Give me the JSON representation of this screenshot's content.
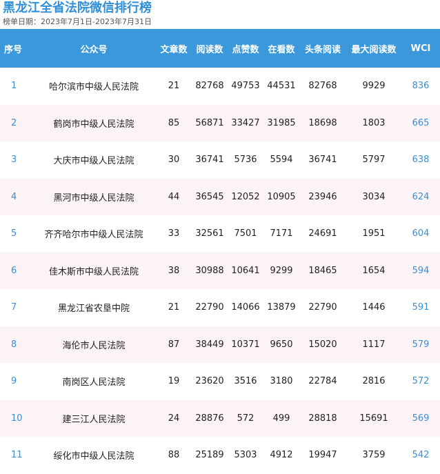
{
  "title": "黑龙江全省法院微信排行榜",
  "subtitle": "榜单日期：2023年7月1日-2023年7月31日",
  "columns": [
    "序号",
    "公众号",
    "文章数",
    "阅读数",
    "点赞数",
    "在看数",
    "头条阅读",
    "最大阅读数",
    "WCI"
  ],
  "rows": [
    [
      "1",
      "哈尔滨市中级人民法院",
      "21",
      "82768",
      "49753",
      "44531",
      "82768",
      "9929",
      "836"
    ],
    [
      "2",
      "鹤岗市中级人民法院",
      "85",
      "56871",
      "33427",
      "31985",
      "18698",
      "1803",
      "665"
    ],
    [
      "3",
      "大庆市中级人民法院",
      "30",
      "36741",
      "5736",
      "5594",
      "36741",
      "5797",
      "638"
    ],
    [
      "4",
      "黑河市中级人民法院",
      "44",
      "36545",
      "12052",
      "10905",
      "23946",
      "3034",
      "624"
    ],
    [
      "5",
      "齐齐哈尔市中级人民法院",
      "33",
      "32561",
      "7501",
      "7171",
      "24691",
      "1951",
      "604"
    ],
    [
      "6",
      "佳木斯市中级人民法院",
      "38",
      "30988",
      "10641",
      "9299",
      "18465",
      "1654",
      "594"
    ],
    [
      "7",
      "黑龙江省农垦中院",
      "21",
      "22790",
      "14066",
      "13879",
      "22790",
      "1446",
      "591"
    ],
    [
      "8",
      "海伦市人民法院",
      "87",
      "38449",
      "10371",
      "9650",
      "15020",
      "1117",
      "579"
    ],
    [
      "9",
      "南岗区人民法院",
      "19",
      "23620",
      "3516",
      "3180",
      "22784",
      "2816",
      "572"
    ],
    [
      "10",
      "建三江人民法院",
      "24",
      "28876",
      "572",
      "499",
      "28818",
      "15691",
      "569"
    ],
    [
      "11",
      "绥化市中级人民法院",
      "88",
      "25189",
      "5303",
      "4912",
      "19947",
      "3759",
      "542"
    ]
  ]
}
